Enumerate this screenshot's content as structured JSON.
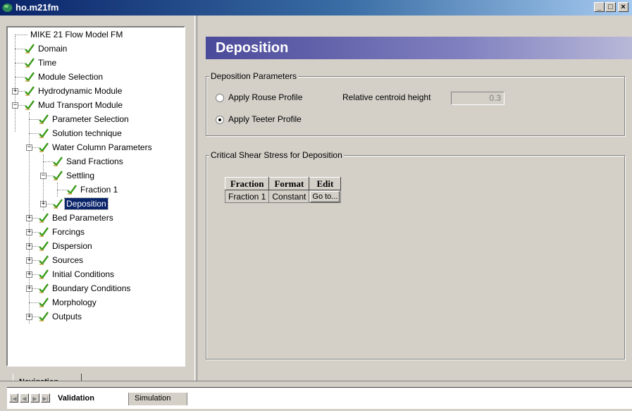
{
  "window": {
    "title": "ho.m21fm",
    "min_label": "_",
    "max_label": "□",
    "close_label": "×"
  },
  "tree": {
    "nodes": [
      {
        "label": "MIKE 21 Flow Model FM"
      },
      {
        "label": "Domain"
      },
      {
        "label": "Time"
      },
      {
        "label": "Module Selection"
      },
      {
        "label": "Hydrodynamic Module"
      },
      {
        "label": "Mud Transport Module"
      },
      {
        "label": "Parameter Selection"
      },
      {
        "label": "Solution technique"
      },
      {
        "label": "Water Column Parameters"
      },
      {
        "label": "Sand Fractions"
      },
      {
        "label": "Settling"
      },
      {
        "label": "Fraction 1"
      },
      {
        "label": "Deposition"
      },
      {
        "label": "Bed Parameters"
      },
      {
        "label": "Forcings"
      },
      {
        "label": "Dispersion"
      },
      {
        "label": "Sources"
      },
      {
        "label": "Initial Conditions"
      },
      {
        "label": "Boundary Conditions"
      },
      {
        "label": "Morphology"
      },
      {
        "label": "Outputs"
      }
    ]
  },
  "navigation_tab": "Navigation",
  "page": {
    "title": "Deposition",
    "deposition_group": {
      "legend": "Deposition Parameters",
      "rouse_label": "Apply Rouse Profile",
      "teeter_label": "Apply Teeter Profile",
      "selected": "teeter",
      "centroid_label": "Relative centroid height",
      "centroid_value": "0.3"
    },
    "shear_group": {
      "legend": "Critical  Shear Stress for Deposition",
      "table": {
        "headers": [
          "Fraction",
          "Format",
          "Edit"
        ],
        "rows": [
          {
            "fraction": "Fraction 1",
            "format": "Constant",
            "edit": "Go to..."
          }
        ]
      }
    }
  },
  "bottom_tabs": [
    "Validation",
    "Simulation"
  ],
  "colors": {
    "selection": "#0a246a",
    "check": "#3a9a1a",
    "header_band": "#6a6ab0"
  }
}
